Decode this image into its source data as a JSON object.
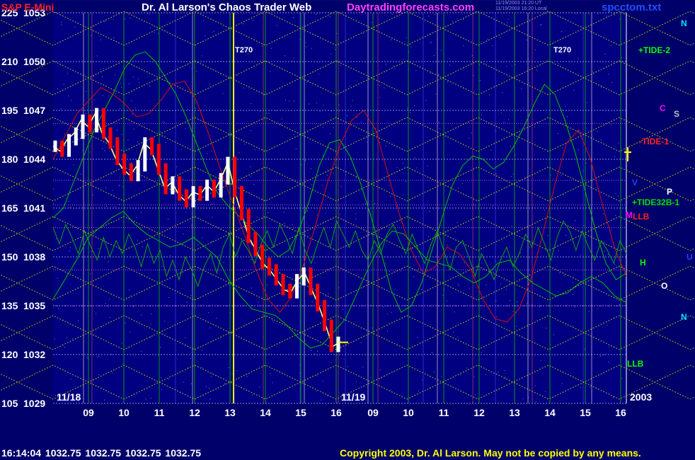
{
  "header": {
    "symbol": "S&P E-Mini",
    "author": "Dr. Al Larson's Chaos Trader Web",
    "site": "Daytradingforecasts.com",
    "timestamp_1": "11/19/2003 21:20 UT",
    "timestamp_2": "11/19/2003 16:20 Local",
    "file": "spcctom.txt"
  },
  "footer": {
    "quote": "16:14:04  1032.75  1032.75  1032.75  1032.75",
    "copyright": "Copyright 2003, Dr. Al Larson. May not be copied by any means."
  },
  "colors": {
    "background": "#00006a",
    "plot_bg": "#000080",
    "price_up": "#ffffff",
    "price_down": "#ff0000",
    "grid_green": "#00c000",
    "grid_yellow": "#e0e000",
    "tide_green": "#00c000",
    "tide_red": "#d01010",
    "noise_green": "#10a010"
  },
  "chart_data": {
    "type": "line",
    "title": "S&P E-Mini",
    "y_left_labels": [
      "225",
      "210",
      "195",
      "180",
      "165",
      "150",
      "135",
      "120",
      "105"
    ],
    "y_right_labels": [
      "1053",
      "1050",
      "1047",
      "1044",
      "1041",
      "1038",
      "1035",
      "1032",
      "1029"
    ],
    "ylim": [
      1029,
      1053
    ],
    "x_tick_labels": [
      "09",
      "10",
      "11",
      "12",
      "13",
      "14",
      "15",
      "16",
      "09",
      "10",
      "11",
      "12",
      "13",
      "14",
      "15",
      "16"
    ],
    "date_labels": [
      "11/18",
      "11/19",
      "2003"
    ],
    "time_markers": [
      "T270",
      "T270"
    ],
    "right_labels": [
      {
        "text": "N",
        "color": "#00e0ff"
      },
      {
        "text": "+TIDE-2",
        "color": "#00ff00"
      },
      {
        "text": "C",
        "color": "#ff00ff"
      },
      {
        "text": "S",
        "color": "#c0c0c0"
      },
      {
        "text": "-TIDE-1",
        "color": "#ff2020"
      },
      {
        "text": "V",
        "color": "#2040ff"
      },
      {
        "text": "P",
        "color": "#ffffff"
      },
      {
        "text": "+TIDE32B-1",
        "color": "#00e000"
      },
      {
        "text": "M",
        "color": "#ff00ff"
      },
      {
        "text": "LLB",
        "color": "#ff2020"
      },
      {
        "text": "U",
        "color": "#2040ff"
      },
      {
        "text": "H",
        "color": "#00ff00"
      },
      {
        "text": "O",
        "color": "#ffffff"
      },
      {
        "text": "N",
        "color": "#00e0ff"
      },
      {
        "text": "LLB",
        "color": "#00ff00"
      }
    ],
    "series": [
      {
        "values": [
          1044.8,
          1044.5,
          1045.2,
          1045.6,
          1046.4,
          1046.0,
          1046.8,
          1045.6,
          1045.0,
          1044.0,
          1043.4,
          1043.0,
          1043.6,
          1045.0,
          1044.6,
          1043.4,
          1042.2,
          1042.6,
          1041.8,
          1041.4,
          1042.0,
          1041.8,
          1042.4,
          1042.0,
          1042.8,
          1043.8,
          1042.0,
          1040.6,
          1039.2,
          1038.4,
          1037.6,
          1037.2,
          1036.6,
          1036.0,
          1035.8,
          1036.6,
          1037.0,
          1036.0,
          1035.0,
          1033.8,
          1032.5,
          1032.75
        ]
      },
      {
        "values": [
          1040.4,
          1041.0,
          1042.6,
          1044.2,
          1045.8,
          1047.0,
          1048.2,
          1049.6,
          1050.4,
          1050.6,
          1050.0,
          1049.0,
          1048.0,
          1046.6,
          1045.0,
          1043.4,
          1042.0,
          1041.2,
          1040.6,
          1040.0,
          1039.4,
          1038.6,
          1038.0,
          1038.4,
          1039.6,
          1041.4,
          1043.6,
          1045.0,
          1045.2,
          1044.2,
          1042.6,
          1040.6,
          1038.4,
          1036.0,
          1034.6,
          1035.0,
          1036.4,
          1038.4,
          1040.4,
          1042.4,
          1043.6,
          1044.2,
          1044.0,
          1043.4,
          1043.8,
          1044.8,
          1046.0,
          1047.4,
          1048.6,
          1048.0,
          1046.4,
          1044.4,
          1042.0,
          1039.6,
          1037.6,
          1036.6,
          1037.0
        ]
      },
      {
        "values": [
          1044.0,
          1045.4,
          1046.8,
          1047.6,
          1048.4,
          1048.0,
          1047.4,
          1046.6,
          1046.8,
          1047.6,
          1048.6,
          1048.8,
          1047.6,
          1045.6,
          1043.4,
          1041.4,
          1039.4,
          1037.2,
          1035.4,
          1034.6,
          1035.6,
          1037.6,
          1040.0,
          1042.6,
          1044.8,
          1046.4,
          1047.0,
          1045.8,
          1043.2,
          1040.6,
          1038.4,
          1037.0,
          1037.4,
          1038.6,
          1038.2,
          1037.2,
          1035.4,
          1034.2,
          1034.0,
          1034.8,
          1036.6,
          1039.4,
          1042.4,
          1045.0,
          1045.8,
          1044.0,
          1041.2,
          1038.6,
          1036.8
        ]
      },
      {
        "values": [
          1035.4,
          1036.6,
          1037.8,
          1039.2,
          1039.8,
          1040.4,
          1040.8,
          1040.0,
          1039.4,
          1039.0,
          1038.6,
          1038.8,
          1039.2,
          1038.6,
          1038.0,
          1036.6,
          1035.6,
          1034.8,
          1034.6,
          1034.4,
          1033.8,
          1033.0,
          1032.4,
          1032.6,
          1033.4,
          1034.2,
          1035.8,
          1037.4,
          1038.8,
          1039.6,
          1039.4,
          1038.6,
          1037.8,
          1037.6,
          1037.4,
          1036.8,
          1036.4,
          1036.8,
          1037.6,
          1037.8,
          1037.0,
          1036.4,
          1036.0,
          1035.6,
          1035.8,
          1036.4,
          1036.8,
          1036.4,
          1035.6,
          1035.2
        ]
      }
    ],
    "noise_values": [
      1039.8,
      1038.8,
      1040.0,
      1039.2,
      1038.2,
      1039.6,
      1038.6,
      1037.8,
      1039.2,
      1038.0,
      1039.0,
      1038.2,
      1039.4,
      1038.6,
      1037.4,
      1038.8,
      1037.6,
      1038.4,
      1036.8,
      1037.8,
      1036.6,
      1038.0,
      1037.2,
      1036.2,
      1037.4,
      1038.2,
      1037.0,
      1038.6,
      1039.4,
      1038.0,
      1039.0,
      1038.4,
      1037.6,
      1038.8,
      1039.6,
      1038.6,
      1040.0,
      1039.2,
      1038.2,
      1039.8,
      1038.4,
      1037.6,
      1038.8,
      1039.8,
      1038.6,
      1040.2,
      1039.4,
      1038.6,
      1039.6,
      1038.4,
      1037.8,
      1039.0,
      1038.2,
      1039.4,
      1040.0,
      1039.0,
      1038.2,
      1039.4,
      1038.4,
      1037.6,
      1038.8,
      1039.6,
      1038.4,
      1037.2,
      1038.6,
      1039.0,
      1038.0,
      1036.8,
      1038.2,
      1037.4,
      1036.6,
      1037.8,
      1038.6,
      1037.4,
      1038.2,
      1039.4,
      1038.6,
      1039.8,
      1038.8,
      1037.8,
      1039.2,
      1040.2,
      1039.6,
      1038.4,
      1039.6,
      1038.6,
      1037.8,
      1039.0,
      1038.4,
      1037.6,
      1039.0,
      1038.2
    ]
  }
}
